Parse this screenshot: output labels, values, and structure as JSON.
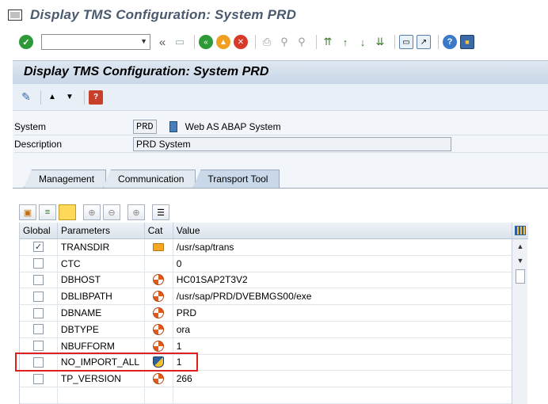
{
  "window": {
    "title": "Display TMS Configuration: System PRD"
  },
  "toolbar": {
    "command_field_value": "",
    "icons": [
      "enter-icon",
      "back-icon",
      "save-icon",
      "exit-icon",
      "cancel-icon",
      "print-icon",
      "find-icon",
      "find-next-icon",
      "first-page-icon",
      "prev-page-icon",
      "next-page-icon",
      "last-page-icon",
      "new-session-icon",
      "shortcut-icon",
      "help-icon",
      "customize-layout-icon"
    ]
  },
  "header": {
    "title": "Display TMS Configuration: System PRD"
  },
  "app_toolbar": {
    "icons": [
      "display-change-icon",
      "previous-object-icon",
      "next-object-icon",
      "help-book-icon"
    ]
  },
  "form": {
    "system_label": "System",
    "system_value": "PRD",
    "system_type": "Web AS ABAP System",
    "description_label": "Description",
    "description_value": "PRD System"
  },
  "tabs": [
    {
      "label": "Management",
      "active": false
    },
    {
      "label": "Communication",
      "active": false
    },
    {
      "label": "Transport Tool",
      "active": true
    }
  ],
  "grid": {
    "headers": {
      "global": "Global",
      "parameters": "Parameters",
      "cat": "Cat",
      "value": "Value"
    },
    "rows": [
      {
        "global": true,
        "parameter": "TRANSDIR",
        "cat": "folder",
        "value": "/usr/sap/trans"
      },
      {
        "global": false,
        "parameter": "CTC",
        "cat": "",
        "value": "0"
      },
      {
        "global": false,
        "parameter": "DBHOST",
        "cat": "orange",
        "value": "HC01SAP2T3V2"
      },
      {
        "global": false,
        "parameter": "DBLIBPATH",
        "cat": "orange",
        "value": "/usr/sap/PRD/DVEBMGS00/exe"
      },
      {
        "global": false,
        "parameter": "DBNAME",
        "cat": "orange",
        "value": "PRD"
      },
      {
        "global": false,
        "parameter": "DBTYPE",
        "cat": "orange",
        "value": "ora"
      },
      {
        "global": false,
        "parameter": "NBUFFORM",
        "cat": "orange",
        "value": "1"
      },
      {
        "global": false,
        "parameter": "NO_IMPORT_ALL",
        "cat": "shield",
        "value": "1"
      },
      {
        "global": false,
        "parameter": "TP_VERSION",
        "cat": "orange",
        "value": "266"
      }
    ]
  },
  "colors": {
    "highlight": "#e02020",
    "header_band": "#c8d6e6",
    "title_text": "#4a5a6e"
  }
}
